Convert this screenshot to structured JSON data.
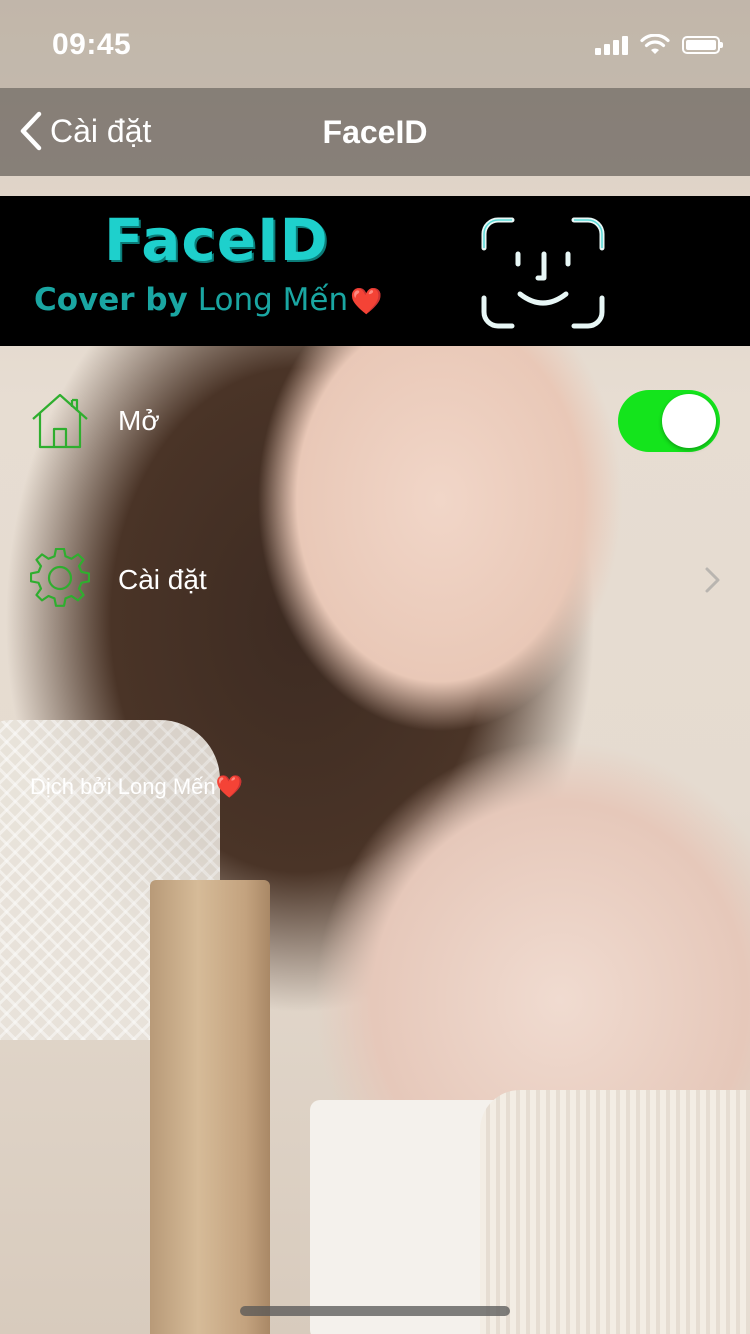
{
  "status_bar": {
    "time": "09:45",
    "icons": [
      "signal-icon",
      "wifi-icon",
      "battery-icon"
    ]
  },
  "nav": {
    "back_label": "Cài đặt",
    "title": "FaceID"
  },
  "banner": {
    "title": "FaceID",
    "cover_label": "Cover by",
    "author": "Long Mến",
    "heart": "❤️",
    "icon": "face-id-icon"
  },
  "rows": [
    {
      "label": "Mở",
      "icon": "home-icon",
      "toggle_on": true
    },
    {
      "label": "Cài đặt",
      "icon": "gear-icon",
      "accessory": "chevron-right-icon"
    }
  ],
  "credit": {
    "text": "Dịch bởi Long Mến",
    "heart": "❤️"
  },
  "colors": {
    "accent_green": "#14e41c",
    "icon_green": "#2fae2f",
    "banner_teal": "#1ed0cc",
    "banner_bg": "#000000"
  }
}
